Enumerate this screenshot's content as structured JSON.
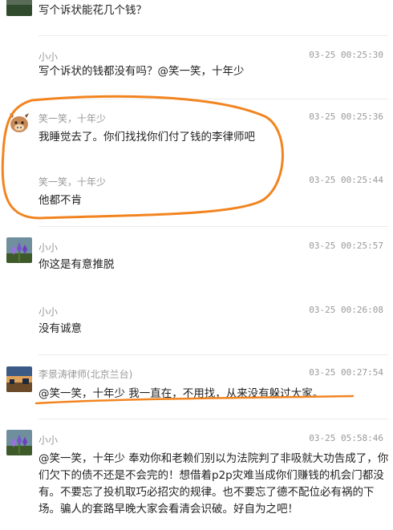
{
  "comments": [
    {
      "name": "",
      "time": "",
      "text": "写个诉状能花几个钱？"
    },
    {
      "name": "小小",
      "time": "03-25 00:25:30",
      "text": "写个诉状的钱都没有吗？@笑一笑，十年少"
    },
    {
      "name": "笑一笑，十年少",
      "time": "03-25 00:25:36",
      "text": "我睡觉去了。你们找找你们付了钱的李律师吧"
    },
    {
      "name": "笑一笑，十年少",
      "time": "03-25 00:25:44",
      "text": "他都不肯"
    },
    {
      "name": "小小",
      "time": "03-25 00:25:57",
      "text": "你这是有意推脱"
    },
    {
      "name": "小小",
      "time": "03-25 00:26:08",
      "text": "没有诚意"
    },
    {
      "name": "李景涛律师(北京兰台)",
      "time": "03-25 00:27:54",
      "text": "@笑一笑，十年少 我一直在，不用找，从来没有躲过大家。"
    },
    {
      "name": "小小",
      "time": "03-25 05:58:46",
      "text": "@笑一笑，十年少 奉劝你和老赖们别以为法院判了非吸就大功告成了，你们欠下的债不还是不会完的！想借着p2p灾难当成你们赚钱的机会门都没有。不要忘了投机取巧必招灾的规律。也不要忘了德不配位必有祸的下场。骗人的套路早晚大家会看清会识破。好自为之吧！"
    }
  ],
  "colors": {
    "annotation": "#f2841f",
    "meta": "#999999",
    "text": "#222222"
  }
}
